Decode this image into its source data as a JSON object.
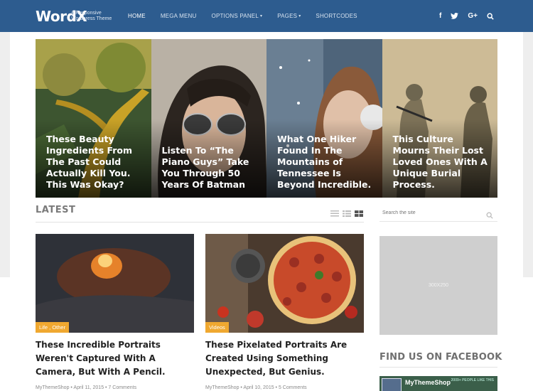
{
  "header": {
    "logo": "WordX",
    "tagline": "A Responsive Wordpress Theme",
    "nav": [
      {
        "label": "HOME",
        "active": true,
        "dropdown": false
      },
      {
        "label": "MEGA MENU",
        "active": false,
        "dropdown": false
      },
      {
        "label": "OPTIONS PANEL",
        "active": false,
        "dropdown": true
      },
      {
        "label": "PAGES",
        "active": false,
        "dropdown": true
      },
      {
        "label": "SHORTCODES",
        "active": false,
        "dropdown": false
      }
    ],
    "social": {
      "facebook": "f",
      "twitter": "twitter-icon",
      "googleplus": "G+",
      "search": "search-icon"
    }
  },
  "slider": [
    {
      "caption": "These Beauty Ingredients From The Past Could Actually Kill You. This Was Okay?"
    },
    {
      "caption": "Listen To “The Piano Guys” Take You Through 50 Years Of Batman"
    },
    {
      "caption": "What One Hiker Found In The Mountains of Tennessee Is Beyond Incredible."
    },
    {
      "caption": "This Culture Mourns Their Lost Loved Ones With A Unique Burial Process."
    }
  ],
  "latest": {
    "heading": "LATEST",
    "posts": [
      {
        "category": "Life , Other",
        "title": "These Incredible Portraits Weren't Captured With A Camera, But With A Pencil.",
        "meta": "MyThemeShop • April 11, 2015 • 7 Comments"
      },
      {
        "category": "Videos",
        "title": "These Pixelated Portraits Are Created Using Something Unexpected, But Genius.",
        "meta": "MyThemeShop • April 10, 2015 • 5 Comments"
      }
    ]
  },
  "sidebar": {
    "search_placeholder": "Search the site",
    "ad_label": "300X250",
    "facebook_heading": "FIND US ON FACEBOOK",
    "facebook_page_name": "MyThemeShop",
    "facebook_likes": "2009+ PEOPLE LIKE THIS"
  },
  "colors": {
    "header": "#2d5c8f",
    "category_tag": "#f0a830"
  }
}
